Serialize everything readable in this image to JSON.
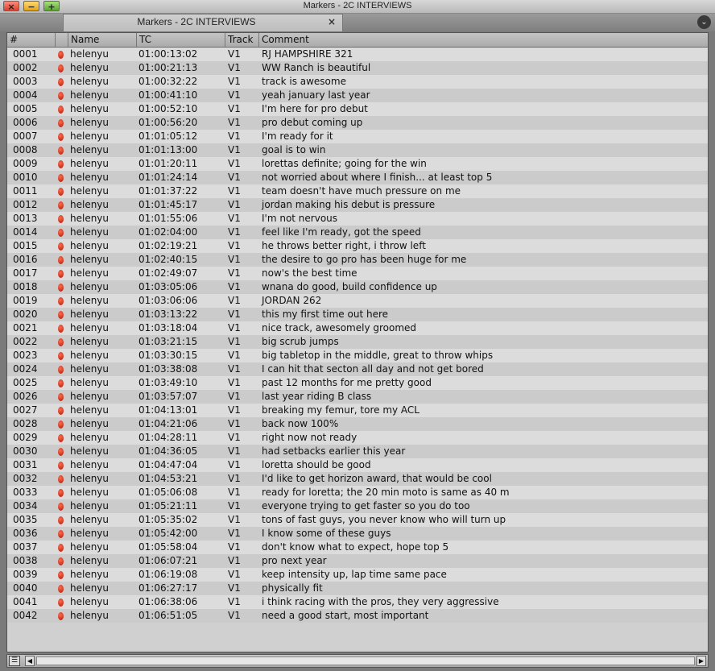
{
  "window": {
    "title": "Markers - 2C INTERVIEWS",
    "close_glyph": "×",
    "minimize_glyph": "−",
    "maximize_glyph": "+"
  },
  "tab": {
    "label": "Markers - 2C INTERVIEWS",
    "close_glyph": "×"
  },
  "menu_glyph": "⌄",
  "columns": {
    "num": "#",
    "color": "",
    "name": "Name",
    "tc": "TC",
    "track": "Track",
    "comment": "Comment"
  },
  "marker_color": "#d02a14",
  "rows": [
    {
      "num": "0001",
      "name": "helenyu",
      "tc": "01:00:13:02",
      "track": "V1",
      "comment": "RJ HAMPSHIRE 321"
    },
    {
      "num": "0002",
      "name": "helenyu",
      "tc": "01:00:21:13",
      "track": "V1",
      "comment": "WW Ranch is beautiful"
    },
    {
      "num": "0003",
      "name": "helenyu",
      "tc": "01:00:32:22",
      "track": "V1",
      "comment": "track is awesome"
    },
    {
      "num": "0004",
      "name": "helenyu",
      "tc": "01:00:41:10",
      "track": "V1",
      "comment": "yeah january last year"
    },
    {
      "num": "0005",
      "name": "helenyu",
      "tc": "01:00:52:10",
      "track": "V1",
      "comment": "I'm here for pro debut"
    },
    {
      "num": "0006",
      "name": "helenyu",
      "tc": "01:00:56:20",
      "track": "V1",
      "comment": "pro debut coming up"
    },
    {
      "num": "0007",
      "name": "helenyu",
      "tc": "01:01:05:12",
      "track": "V1",
      "comment": "I'm ready for it"
    },
    {
      "num": "0008",
      "name": "helenyu",
      "tc": "01:01:13:00",
      "track": "V1",
      "comment": "goal is to win"
    },
    {
      "num": "0009",
      "name": "helenyu",
      "tc": "01:01:20:11",
      "track": "V1",
      "comment": "lorettas definite; going for the win"
    },
    {
      "num": "0010",
      "name": "helenyu",
      "tc": "01:01:24:14",
      "track": "V1",
      "comment": "not worried about where I finish... at least top 5"
    },
    {
      "num": "0011",
      "name": "helenyu",
      "tc": "01:01:37:22",
      "track": "V1",
      "comment": "team doesn't have much pressure on me"
    },
    {
      "num": "0012",
      "name": "helenyu",
      "tc": "01:01:45:17",
      "track": "V1",
      "comment": "jordan making his debut is pressure"
    },
    {
      "num": "0013",
      "name": "helenyu",
      "tc": "01:01:55:06",
      "track": "V1",
      "comment": "I'm not nervous"
    },
    {
      "num": "0014",
      "name": "helenyu",
      "tc": "01:02:04:00",
      "track": "V1",
      "comment": "feel like I'm ready, got the speed"
    },
    {
      "num": "0015",
      "name": "helenyu",
      "tc": "01:02:19:21",
      "track": "V1",
      "comment": "he throws better right, i throw left"
    },
    {
      "num": "0016",
      "name": "helenyu",
      "tc": "01:02:40:15",
      "track": "V1",
      "comment": "the desire to go pro has been huge for me"
    },
    {
      "num": "0017",
      "name": "helenyu",
      "tc": "01:02:49:07",
      "track": "V1",
      "comment": "now's the best time"
    },
    {
      "num": "0018",
      "name": "helenyu",
      "tc": "01:03:05:06",
      "track": "V1",
      "comment": "wnana do good, build confidence up"
    },
    {
      "num": "0019",
      "name": "helenyu",
      "tc": "01:03:06:06",
      "track": "V1",
      "comment": "JORDAN 262"
    },
    {
      "num": "0020",
      "name": "helenyu",
      "tc": "01:03:13:22",
      "track": "V1",
      "comment": "this my first time out here"
    },
    {
      "num": "0021",
      "name": "helenyu",
      "tc": "01:03:18:04",
      "track": "V1",
      "comment": "nice track, awesomely groomed"
    },
    {
      "num": "0022",
      "name": "helenyu",
      "tc": "01:03:21:15",
      "track": "V1",
      "comment": "big scrub jumps"
    },
    {
      "num": "0023",
      "name": "helenyu",
      "tc": "01:03:30:15",
      "track": "V1",
      "comment": "big tabletop in the middle, great to throw whips"
    },
    {
      "num": "0024",
      "name": "helenyu",
      "tc": "01:03:38:08",
      "track": "V1",
      "comment": "I can hit that secton all day and not get bored"
    },
    {
      "num": "0025",
      "name": "helenyu",
      "tc": "01:03:49:10",
      "track": "V1",
      "comment": "past 12 months for me pretty good"
    },
    {
      "num": "0026",
      "name": "helenyu",
      "tc": "01:03:57:07",
      "track": "V1",
      "comment": "last year riding B class"
    },
    {
      "num": "0027",
      "name": "helenyu",
      "tc": "01:04:13:01",
      "track": "V1",
      "comment": "breaking my femur, tore my ACL"
    },
    {
      "num": "0028",
      "name": "helenyu",
      "tc": "01:04:21:06",
      "track": "V1",
      "comment": "back now 100%"
    },
    {
      "num": "0029",
      "name": "helenyu",
      "tc": "01:04:28:11",
      "track": "V1",
      "comment": "right now not ready"
    },
    {
      "num": "0030",
      "name": "helenyu",
      "tc": "01:04:36:05",
      "track": "V1",
      "comment": "had setbacks earlier this year"
    },
    {
      "num": "0031",
      "name": "helenyu",
      "tc": "01:04:47:04",
      "track": "V1",
      "comment": "loretta should be good"
    },
    {
      "num": "0032",
      "name": "helenyu",
      "tc": "01:04:53:21",
      "track": "V1",
      "comment": "I'd like to get horizon award, that would be cool"
    },
    {
      "num": "0033",
      "name": "helenyu",
      "tc": "01:05:06:08",
      "track": "V1",
      "comment": "ready for loretta; the 20 min moto is same as 40 m"
    },
    {
      "num": "0034",
      "name": "helenyu",
      "tc": "01:05:21:11",
      "track": "V1",
      "comment": "everyone trying to get faster so you do too"
    },
    {
      "num": "0035",
      "name": "helenyu",
      "tc": "01:05:35:02",
      "track": "V1",
      "comment": "tons of fast guys, you never know who will turn up"
    },
    {
      "num": "0036",
      "name": "helenyu",
      "tc": "01:05:42:00",
      "track": "V1",
      "comment": "I know some of these guys"
    },
    {
      "num": "0037",
      "name": "helenyu",
      "tc": "01:05:58:04",
      "track": "V1",
      "comment": "don't know what to expect, hope top 5"
    },
    {
      "num": "0038",
      "name": "helenyu",
      "tc": "01:06:07:21",
      "track": "V1",
      "comment": "pro next year"
    },
    {
      "num": "0039",
      "name": "helenyu",
      "tc": "01:06:19:08",
      "track": "V1",
      "comment": "keep intensity up, lap time same pace"
    },
    {
      "num": "0040",
      "name": "helenyu",
      "tc": "01:06:27:17",
      "track": "V1",
      "comment": "physically fit"
    },
    {
      "num": "0041",
      "name": "helenyu",
      "tc": "01:06:38:06",
      "track": "V1",
      "comment": "i think racing with the pros, they very aggressive"
    },
    {
      "num": "0042",
      "name": "helenyu",
      "tc": "01:06:51:05",
      "track": "V1",
      "comment": "need a good start, most important"
    }
  ],
  "scroll": {
    "left_glyph": "◀",
    "right_glyph": "▶",
    "view_glyph": "☰"
  }
}
